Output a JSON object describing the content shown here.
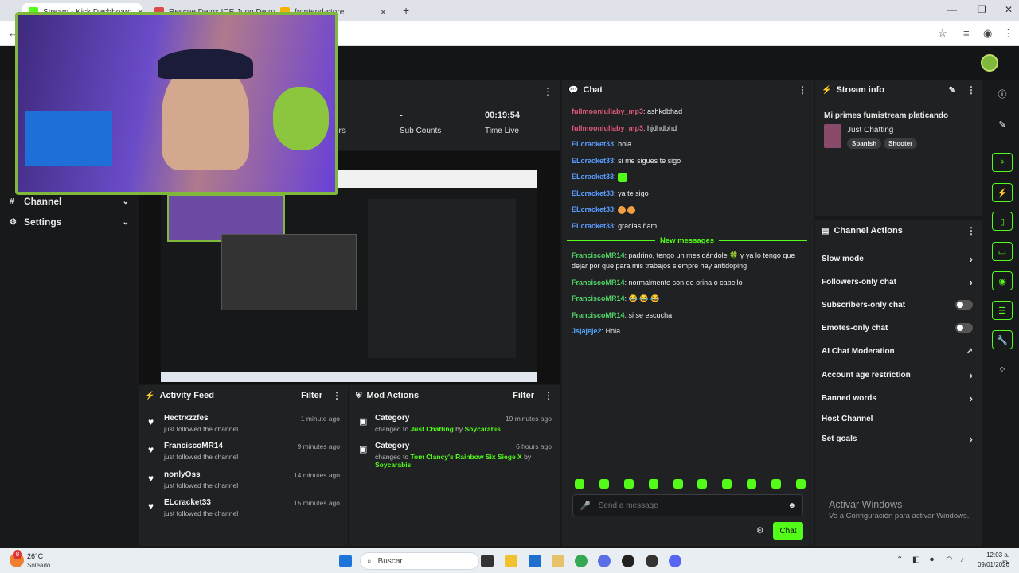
{
  "browser": {
    "tabs": [
      {
        "title": "Stream - Kick Dashboard",
        "active": true
      },
      {
        "title": "Rescue Detox ICE Jugo Detox -",
        "active": false
      },
      {
        "title": "frontend-store",
        "active": false
      }
    ],
    "new_tab": "+"
  },
  "sidebar": {
    "items": [
      {
        "label": "Channel",
        "icon": "hashtag-icon"
      },
      {
        "label": "Settings",
        "icon": "gear-icon"
      }
    ]
  },
  "stats": {
    "partial_label": "ers",
    "sub_counts_value": "-",
    "sub_counts_label": "Sub Counts",
    "time_live_value": "00:19:54",
    "time_live_label": "Time Live"
  },
  "chat": {
    "title": "Chat",
    "messages": [
      {
        "user": "fullmoonlullaby_mp3",
        "text": "ashkdbhad",
        "color": "pink"
      },
      {
        "user": "fullmoonlullaby_mp3",
        "text": "hjdhdbhd",
        "color": "pink"
      },
      {
        "user": "ELcracket33",
        "text": "hola",
        "color": "blue"
      },
      {
        "user": "ELcracket33",
        "text": "si me sigues te sigo",
        "color": "blue"
      },
      {
        "user": "ELcracket33",
        "text": "",
        "color": "blue",
        "emote": true
      },
      {
        "user": "ELcracket33",
        "text": "ya te sigo",
        "color": "blue"
      },
      {
        "user": "ELcracket33",
        "text": "",
        "color": "blue",
        "emoji": true
      },
      {
        "user": "ELcracket33",
        "text": "gracias ñam",
        "color": "blue"
      }
    ],
    "divider": "New messages",
    "new_messages": [
      {
        "user": "FranciscoMR14",
        "text": "padrino, tengo un mes dándole 🍀 y ya lo tengo que dejar por que para mis trabajos siempre hay antidoping",
        "color": "green"
      },
      {
        "user": "FranciscoMR14",
        "text": "normalmente son de orina o cabello",
        "color": "green"
      },
      {
        "user": "FranciscoMR14",
        "text": "😂 😂 😂",
        "color": "green"
      },
      {
        "user": "FranciscoMR14",
        "text": "si se escucha",
        "color": "green"
      },
      {
        "user": "Jsjajeje2",
        "text": "Hola",
        "color": "cyan"
      }
    ],
    "input_placeholder": "Send a message",
    "send_label": "Chat"
  },
  "stream_info": {
    "title": "Stream info",
    "stream_title": "Mi primes fumistream platicando",
    "category": "Just Chatting",
    "tags": [
      "Spanish",
      "Shooter"
    ]
  },
  "channel_actions": {
    "title": "Channel Actions",
    "items": [
      {
        "label": "Slow mode",
        "control": "chevron"
      },
      {
        "label": "Followers-only chat",
        "control": "chevron"
      },
      {
        "label": "Subscribers-only chat",
        "control": "toggle"
      },
      {
        "label": "Emotes-only chat",
        "control": "toggle"
      },
      {
        "label": "AI Chat Moderation",
        "control": "external"
      },
      {
        "label": "Account age restriction",
        "control": "chevron"
      },
      {
        "label": "Banned words",
        "control": "chevron"
      },
      {
        "label": "Host Channel",
        "control": "none"
      },
      {
        "label": "Set goals",
        "control": "chevron"
      }
    ]
  },
  "activity_feed": {
    "title": "Activity Feed",
    "filter": "Filter",
    "items": [
      {
        "name": "Hectrxzzfes",
        "sub": "just followed the channel",
        "time": "1 minute ago"
      },
      {
        "name": "FranciscoMR14",
        "sub": "just followed the channel",
        "time": "9 minutes ago"
      },
      {
        "name": "nonlyOss",
        "sub": "just followed the channel",
        "time": "14 minutes ago"
      },
      {
        "name": "ELcracket33",
        "sub": "just followed the channel",
        "time": "15 minutes ago"
      }
    ]
  },
  "mod_actions": {
    "title": "Mod Actions",
    "filter": "Filter",
    "items": [
      {
        "title": "Category",
        "time": "19 minutes ago",
        "prefix": "changed to",
        "target": "Just Chatting",
        "by": "by",
        "actor": "Soycarabis"
      },
      {
        "title": "Category",
        "time": "6 hours ago",
        "prefix": "changed to",
        "target": "Tom Clancy's Rainbow Six Siege X",
        "by": "by",
        "actor": "Soycarabis"
      }
    ]
  },
  "watermark": {
    "line1": "Activar Windows",
    "line2": "Ve a Configuración para activar Windows."
  },
  "taskbar": {
    "weather_temp": "26°C",
    "weather_desc": "Soleado",
    "search": "Buscar",
    "time": "12:03 a. m.",
    "date": "09/01/2026",
    "badge": "8"
  },
  "colors": {
    "accent": "#53fc18",
    "background": "#18191b",
    "panel": "#1f2123"
  }
}
